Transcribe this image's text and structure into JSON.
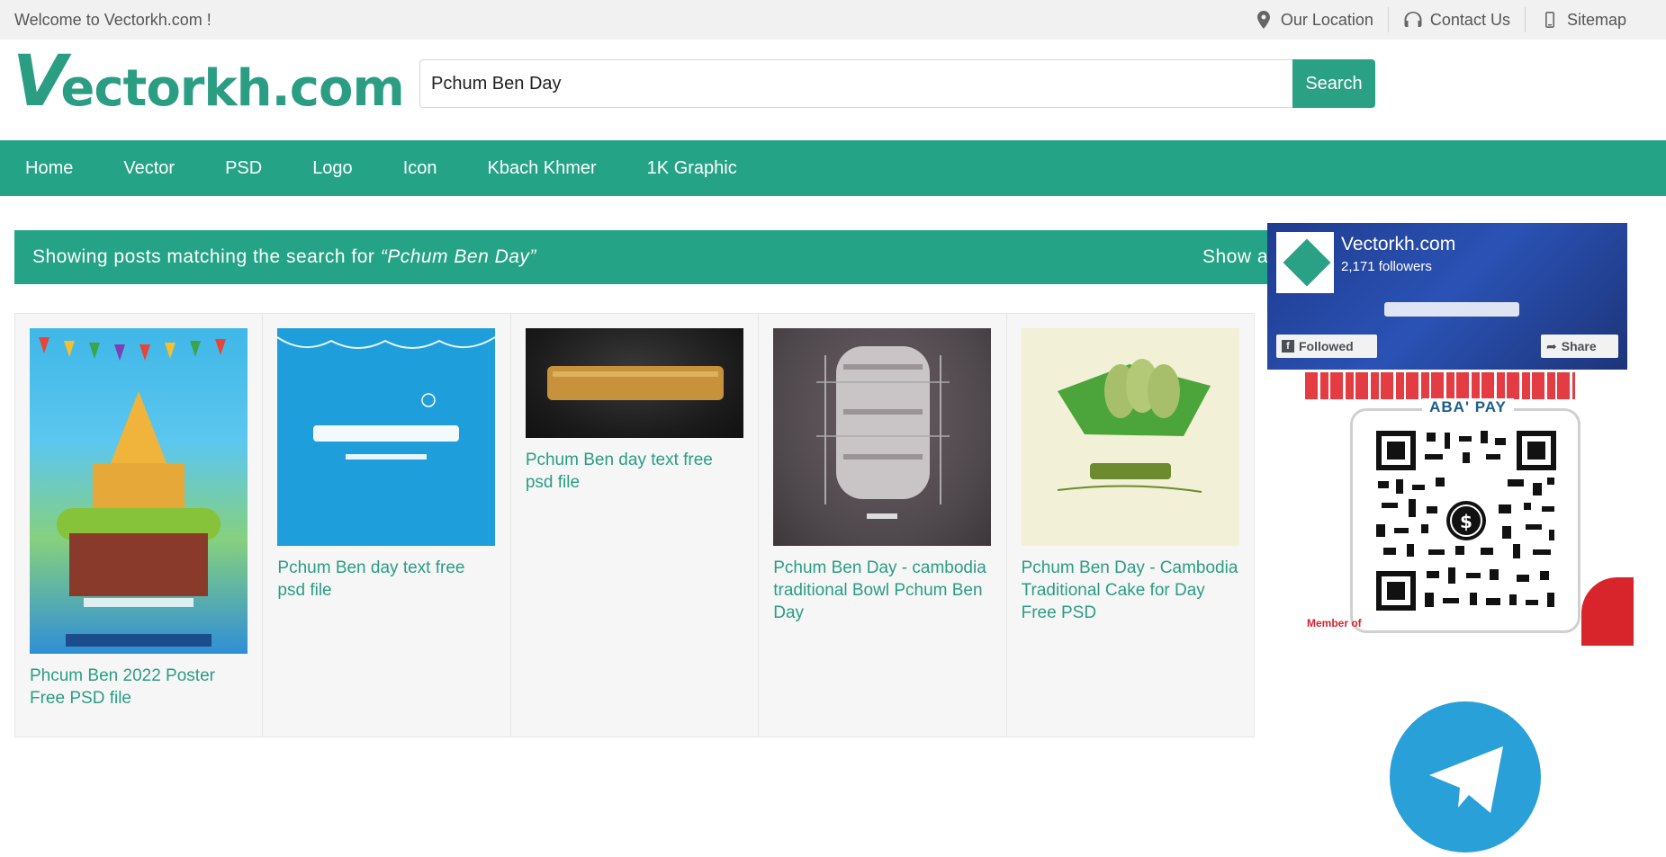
{
  "topbar": {
    "welcome": "Welcome to Vectorkh.com !",
    "links": [
      {
        "label": "Our Location",
        "icon": "map-pin-icon"
      },
      {
        "label": "Contact Us",
        "icon": "headphones-icon"
      },
      {
        "label": "Sitemap",
        "icon": "mobile-icon"
      }
    ]
  },
  "header": {
    "logo_letter": "V",
    "logo_rest": "ectorkh.com",
    "search_value": "Pchum Ben Day",
    "search_button": "Search"
  },
  "nav": {
    "items": [
      "Home",
      "Vector",
      "PSD",
      "Logo",
      "Icon",
      "Kbach Khmer",
      "1K Graphic"
    ]
  },
  "banner": {
    "prefix": "Showing posts matching the search for ",
    "query": "“Pchum Ben Day”",
    "show_all": "Show all"
  },
  "posts": [
    {
      "title": "Phcum Ben 2022 Poster Free PSD file"
    },
    {
      "title": "Pchum Ben day text free psd file"
    },
    {
      "title": "Pchum Ben day text free psd file"
    },
    {
      "title": "Pchum Ben Day - cambodia traditional Bowl Pchum Ben Day"
    },
    {
      "title": "Pchum Ben Day - Cambodia Traditional Cake for Day Free PSD"
    }
  ],
  "facebook": {
    "name": "Vectorkh.com",
    "followers": "2,171 followers",
    "followed": "Followed",
    "share": "Share"
  },
  "aba": {
    "label": "ABA' PAY",
    "member": "Member of"
  },
  "colors": {
    "brand": "#24a386",
    "topbar": "#f1f1f1",
    "card_bg": "#f6f6f6"
  }
}
